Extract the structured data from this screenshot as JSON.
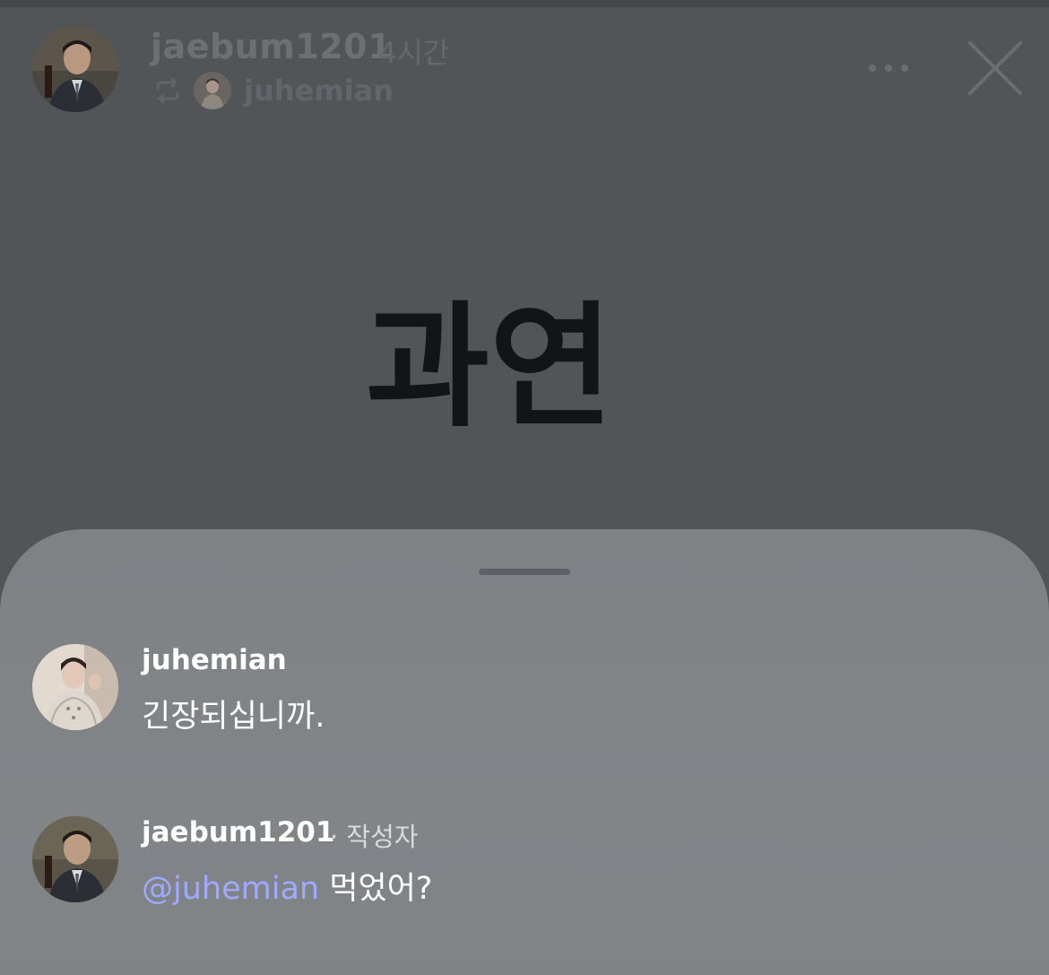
{
  "post": {
    "author": "jaebum1201",
    "time": "4시간",
    "reposted_by": "juhemian",
    "text": "과연"
  },
  "icons": {
    "repost": "repost-icon",
    "more": "more-icon",
    "close": "close-icon"
  },
  "comments": [
    {
      "user": "juhemian",
      "meta": "",
      "mention": "",
      "text": "긴장되십니까."
    },
    {
      "user": "jaebum1201",
      "meta": "· 작성자",
      "mention": "@juhemian",
      "text": " 먹었어?"
    }
  ],
  "colors": {
    "background": "#525557",
    "sheet": "#7f8386",
    "mention": "#a0a9ff"
  }
}
